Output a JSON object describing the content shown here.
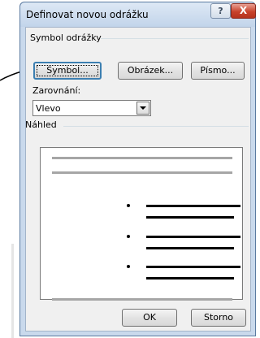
{
  "dialog": {
    "title": "Definovat novou odrážku",
    "help_label": "?",
    "close_label": "X"
  },
  "group": {
    "symbol_label": "Symbol odrážky",
    "preview_label": "Náhled"
  },
  "buttons": {
    "symbol": "Symbol...",
    "image": "Obrázek...",
    "font": "Písmo...",
    "ok": "OK",
    "cancel": "Storno"
  },
  "alignment": {
    "label": "Zarovnání:",
    "value": "Vlevo"
  },
  "colors": {
    "accent": "#3c7fb1",
    "preview_line_gray": "#a6a6a6",
    "bullet_line": "#000000"
  }
}
